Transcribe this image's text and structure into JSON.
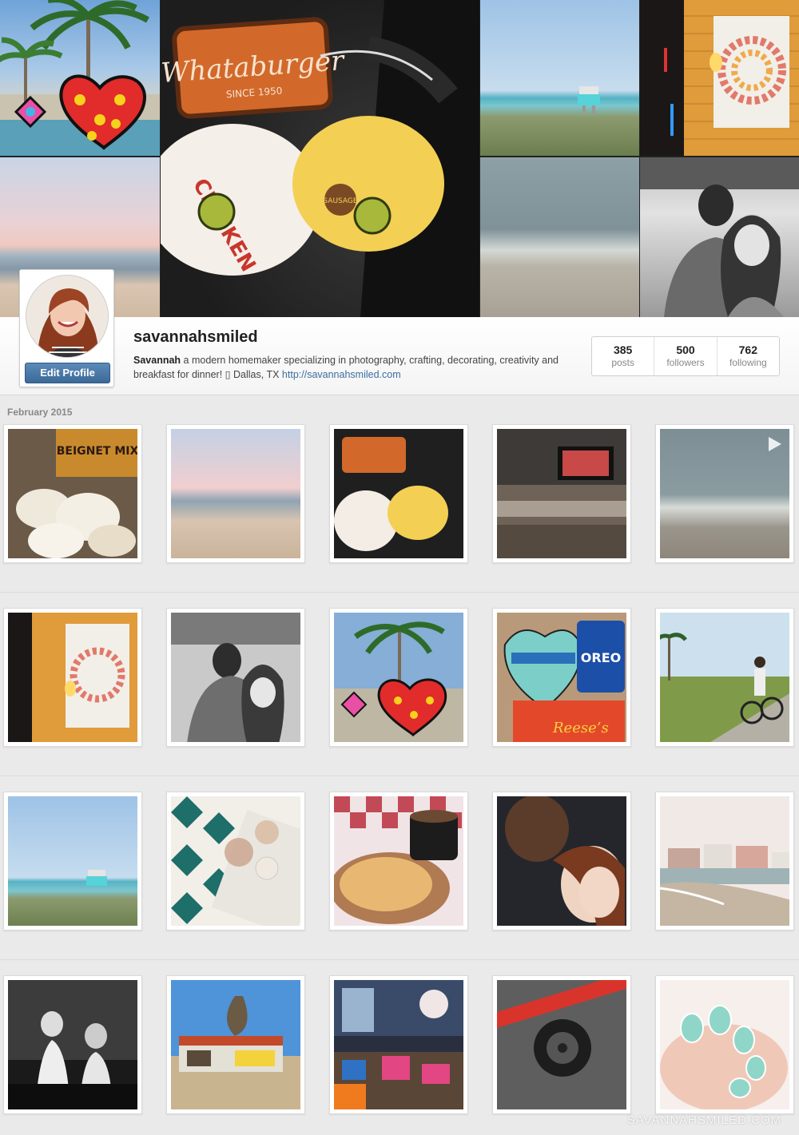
{
  "header": {
    "tiles": [
      {
        "name": "palm-heart-photo",
        "description": "palm trees with heart sculpture"
      },
      {
        "name": "beach-sunset-photo",
        "description": "beach sunset"
      },
      {
        "name": "whataburger-photo",
        "description": "whataburger tag and sandwiches"
      },
      {
        "name": "beach-lifeguard-photo",
        "description": "beach with lifeguard tower"
      },
      {
        "name": "wave-photo",
        "description": "waves on sand"
      },
      {
        "name": "donut-poster-photo",
        "description": "donut poster on brick wall"
      },
      {
        "name": "couple-selfie-photo",
        "description": "black and white couple selfie"
      }
    ]
  },
  "profile": {
    "username": "savannahsmiled",
    "edit_label": "Edit Profile",
    "bio_name": "Savannah",
    "bio_text": " a modern homemaker specializing in photography, crafting, decorating, creativity and breakfast for dinner! ",
    "bio_location": " Dallas, TX ",
    "website": "http://savannahsmiled.com"
  },
  "stats": [
    {
      "value": "385",
      "label": "posts"
    },
    {
      "value": "500",
      "label": "followers"
    },
    {
      "value": "762",
      "label": "following"
    }
  ],
  "feed": {
    "month": "February 2015",
    "rows": [
      [
        "beignets",
        "pastel-beach",
        "whataburger",
        "airport",
        "waves"
      ],
      [
        "donut-poster",
        "couple-bw",
        "palm-heart",
        "valentine-candy",
        "bike-path"
      ],
      [
        "lifeguard-tower",
        "tray-rug",
        "waffle",
        "couple-selfie",
        "hotel-beach"
      ],
      [
        "bakery-show",
        "taqueria",
        "diner-interior",
        "tire",
        "nails"
      ]
    ]
  },
  "colors": {
    "link": "#3b6e9e",
    "button": "#3c6a98",
    "background": "#eaeaea"
  },
  "watermark": "SAVANNAHSMILED.COM"
}
